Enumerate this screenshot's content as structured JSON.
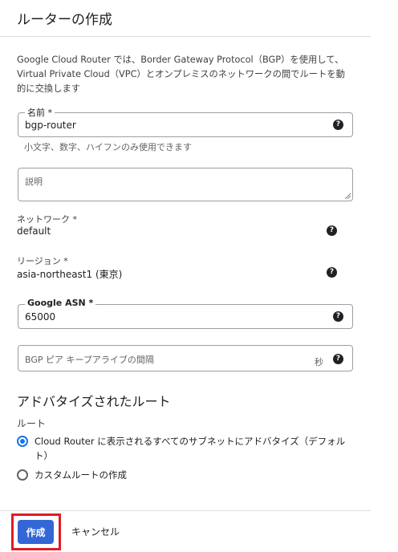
{
  "header": {
    "title": "ルーターの作成"
  },
  "description": "Google Cloud Router では、Border Gateway Protocol（BGP）を使用して、Virtual Private Cloud（VPC）とオンプレミスのネットワークの間でルートを動的に交換します",
  "name_field": {
    "label": "名前 *",
    "value": "bgp-router",
    "hint": "小文字、数字、ハイフンのみ使用できます"
  },
  "description_field": {
    "placeholder": "説明"
  },
  "network": {
    "label": "ネットワーク *",
    "value": "default"
  },
  "region": {
    "label": "リージョン *",
    "value": "asia-northeast1 (東京)"
  },
  "asn_field": {
    "label": "Google ASN *",
    "value": "65000"
  },
  "keepalive_field": {
    "placeholder": "BGP ピア キープアライブの間隔",
    "suffix": "秒"
  },
  "advertised_routes": {
    "title": "アドバタイズされたルート",
    "group_label": "ルート",
    "options": [
      {
        "label": "Cloud Router に表示されるすべてのサブネットにアドバタイズ（デフォルト）",
        "checked": true
      },
      {
        "label": "カスタムルートの作成",
        "checked": false
      }
    ]
  },
  "footer": {
    "create_label": "作成",
    "cancel_label": "キャンセル"
  },
  "icons": {
    "help": "help-icon",
    "radio": "radio-icon"
  },
  "colors": {
    "primary": "#3367d6",
    "highlight": "#e01b24",
    "radio_selected": "#1a73e8"
  }
}
